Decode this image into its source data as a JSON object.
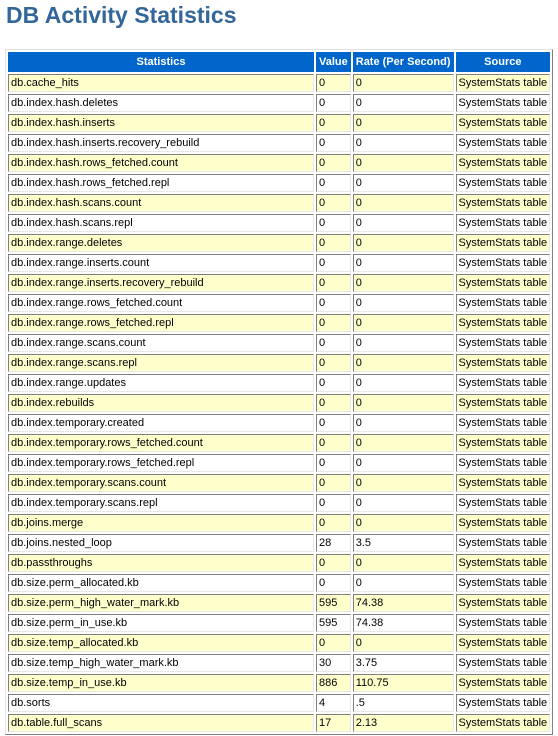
{
  "page": {
    "title": "DB Activity Statistics"
  },
  "colors": {
    "title": "#336699",
    "header_bg": "#0066CC",
    "row_alt": "#FFFFCC",
    "row_plain": "#FFFFFF"
  },
  "table": {
    "headers": [
      "Statistics",
      "Value",
      "Rate (Per Second)",
      "Source"
    ],
    "rows": [
      {
        "stat": "db.cache_hits",
        "value": "0",
        "rate": "0",
        "source": "SystemStats table"
      },
      {
        "stat": "db.index.hash.deletes",
        "value": "0",
        "rate": "0",
        "source": "SystemStats table"
      },
      {
        "stat": "db.index.hash.inserts",
        "value": "0",
        "rate": "0",
        "source": "SystemStats table"
      },
      {
        "stat": "db.index.hash.inserts.recovery_rebuild",
        "value": "0",
        "rate": "0",
        "source": "SystemStats table"
      },
      {
        "stat": "db.index.hash.rows_fetched.count",
        "value": "0",
        "rate": "0",
        "source": "SystemStats table"
      },
      {
        "stat": "db.index.hash.rows_fetched.repl",
        "value": "0",
        "rate": "0",
        "source": "SystemStats table"
      },
      {
        "stat": "db.index.hash.scans.count",
        "value": "0",
        "rate": "0",
        "source": "SystemStats table"
      },
      {
        "stat": "db.index.hash.scans.repl",
        "value": "0",
        "rate": "0",
        "source": "SystemStats table"
      },
      {
        "stat": "db.index.range.deletes",
        "value": "0",
        "rate": "0",
        "source": "SystemStats table"
      },
      {
        "stat": "db.index.range.inserts.count",
        "value": "0",
        "rate": "0",
        "source": "SystemStats table"
      },
      {
        "stat": "db.index.range.inserts.recovery_rebuild",
        "value": "0",
        "rate": "0",
        "source": "SystemStats table"
      },
      {
        "stat": "db.index.range.rows_fetched.count",
        "value": "0",
        "rate": "0",
        "source": "SystemStats table"
      },
      {
        "stat": "db.index.range.rows_fetched.repl",
        "value": "0",
        "rate": "0",
        "source": "SystemStats table"
      },
      {
        "stat": "db.index.range.scans.count",
        "value": "0",
        "rate": "0",
        "source": "SystemStats table"
      },
      {
        "stat": "db.index.range.scans.repl",
        "value": "0",
        "rate": "0",
        "source": "SystemStats table"
      },
      {
        "stat": "db.index.range.updates",
        "value": "0",
        "rate": "0",
        "source": "SystemStats table"
      },
      {
        "stat": "db.index.rebuilds",
        "value": "0",
        "rate": "0",
        "source": "SystemStats table"
      },
      {
        "stat": "db.index.temporary.created",
        "value": "0",
        "rate": "0",
        "source": "SystemStats table"
      },
      {
        "stat": "db.index.temporary.rows_fetched.count",
        "value": "0",
        "rate": "0",
        "source": "SystemStats table"
      },
      {
        "stat": "db.index.temporary.rows_fetched.repl",
        "value": "0",
        "rate": "0",
        "source": "SystemStats table"
      },
      {
        "stat": "db.index.temporary.scans.count",
        "value": "0",
        "rate": "0",
        "source": "SystemStats table"
      },
      {
        "stat": "db.index.temporary.scans.repl",
        "value": "0",
        "rate": "0",
        "source": "SystemStats table"
      },
      {
        "stat": "db.joins.merge",
        "value": "0",
        "rate": "0",
        "source": "SystemStats table"
      },
      {
        "stat": "db.joins.nested_loop",
        "value": "28",
        "rate": "3.5",
        "source": "SystemStats table"
      },
      {
        "stat": "db.passthroughs",
        "value": "0",
        "rate": "0",
        "source": "SystemStats table"
      },
      {
        "stat": "db.size.perm_allocated.kb",
        "value": "0",
        "rate": "0",
        "source": "SystemStats table"
      },
      {
        "stat": "db.size.perm_high_water_mark.kb",
        "value": "595",
        "rate": "74.38",
        "source": "SystemStats table"
      },
      {
        "stat": "db.size.perm_in_use.kb",
        "value": "595",
        "rate": "74.38",
        "source": "SystemStats table"
      },
      {
        "stat": "db.size.temp_allocated.kb",
        "value": "0",
        "rate": "0",
        "source": "SystemStats table"
      },
      {
        "stat": "db.size.temp_high_water_mark.kb",
        "value": "30",
        "rate": "3.75",
        "source": "SystemStats table"
      },
      {
        "stat": "db.size.temp_in_use.kb",
        "value": "886",
        "rate": "110.75",
        "source": "SystemStats table"
      },
      {
        "stat": "db.sorts",
        "value": "4",
        "rate": ".5",
        "source": "SystemStats table"
      },
      {
        "stat": "db.table.full_scans",
        "value": "17",
        "rate": "2.13",
        "source": "SystemStats table"
      }
    ]
  }
}
